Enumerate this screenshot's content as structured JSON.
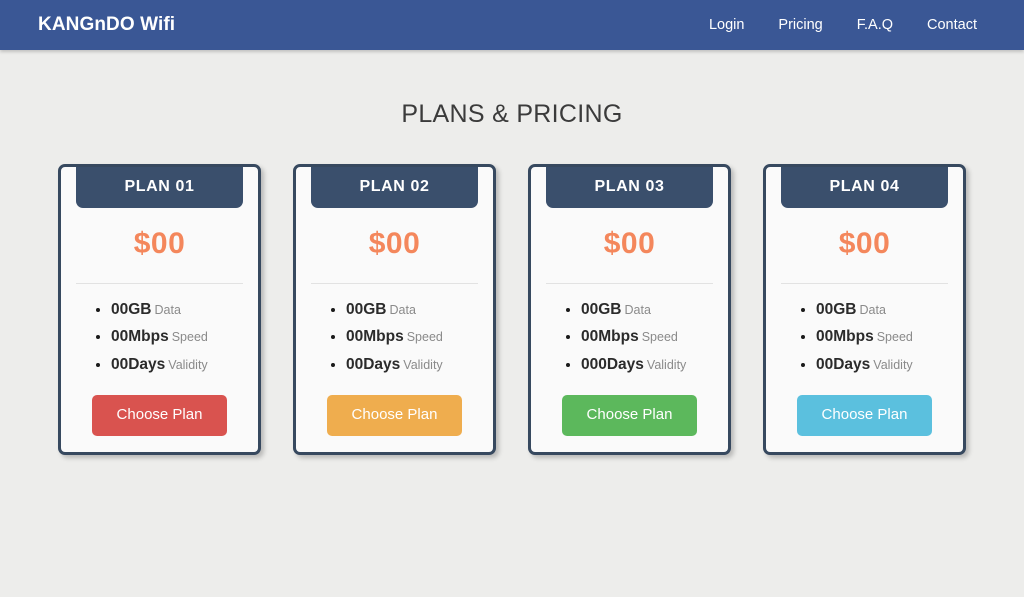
{
  "navbar": {
    "brand": "KANGnDO Wifi",
    "brand_color": "#ffffff",
    "background_color": "#3a5795",
    "links": [
      {
        "label": "Login"
      },
      {
        "label": "Pricing"
      },
      {
        "label": "F.A.Q"
      },
      {
        "label": "Contact"
      }
    ]
  },
  "page": {
    "title": "PLANS & PRICING",
    "background_color": "#ededeb"
  },
  "plans": [
    {
      "name": "PLAN 01",
      "price": "$00",
      "features": [
        {
          "value": "00GB",
          "label": "Data"
        },
        {
          "value": "00Mbps",
          "label": "Speed"
        },
        {
          "value": "00Days",
          "label": "Validity"
        }
      ],
      "button_label": "Choose Plan",
      "button_color": "#d9534f"
    },
    {
      "name": "PLAN 02",
      "price": "$00",
      "features": [
        {
          "value": "00GB",
          "label": "Data"
        },
        {
          "value": "00Mbps",
          "label": "Speed"
        },
        {
          "value": "00Days",
          "label": "Validity"
        }
      ],
      "button_label": "Choose Plan",
      "button_color": "#efad4e"
    },
    {
      "name": "PLAN 03",
      "price": "$00",
      "features": [
        {
          "value": "00GB",
          "label": "Data"
        },
        {
          "value": "00Mbps",
          "label": "Speed"
        },
        {
          "value": "000Days",
          "label": "Validity"
        }
      ],
      "button_label": "Choose Plan",
      "button_color": "#5cb85c"
    },
    {
      "name": "PLAN 04",
      "price": "$00",
      "features": [
        {
          "value": "00GB",
          "label": "Data"
        },
        {
          "value": "00Mbps",
          "label": "Speed"
        },
        {
          "value": "00Days",
          "label": "Validity"
        }
      ],
      "button_label": "Choose Plan",
      "button_color": "#5bc0de"
    }
  ],
  "theme": {
    "card_border_color": "#37495f",
    "card_header_color": "#3a4f6c",
    "price_color": "#f4875c",
    "card_background": "#fafafa"
  }
}
